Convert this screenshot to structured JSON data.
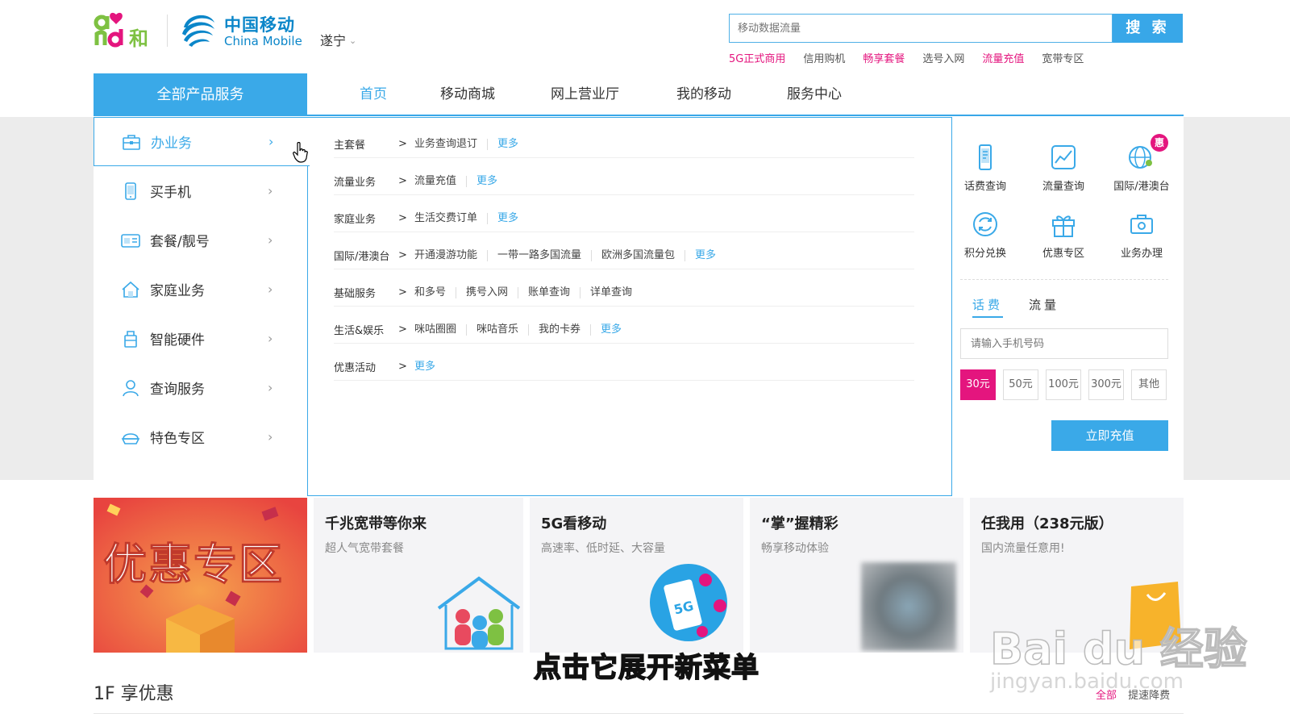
{
  "header": {
    "logo_left_text": "and和",
    "brand_cn": "中国移动",
    "brand_en": "China Mobile",
    "city": "遂宁",
    "search_placeholder": "移动数据流量",
    "search_button": "搜 索",
    "hot_words": [
      {
        "label": "5G正式商用",
        "highlight": true
      },
      {
        "label": "信用购机",
        "highlight": false
      },
      {
        "label": "畅享套餐",
        "highlight": true
      },
      {
        "label": "选号入网",
        "highlight": false
      },
      {
        "label": "流量充值",
        "highlight": true
      },
      {
        "label": "宽带专区",
        "highlight": false
      }
    ]
  },
  "nav": {
    "all_products": "全部产品服务",
    "items": [
      "首页",
      "移动商城",
      "网上营业厅",
      "我的移动",
      "服务中心"
    ],
    "active_index": 0
  },
  "sidebar": {
    "items": [
      {
        "label": "办业务",
        "icon": "briefcase-icon"
      },
      {
        "label": "买手机",
        "icon": "phone-icon"
      },
      {
        "label": "套餐/靓号",
        "icon": "card-icon"
      },
      {
        "label": "家庭业务",
        "icon": "home-icon"
      },
      {
        "label": "智能硬件",
        "icon": "device-icon"
      },
      {
        "label": "查询服务",
        "icon": "user-icon"
      },
      {
        "label": "特色专区",
        "icon": "special-icon"
      }
    ],
    "arrow": "›",
    "active_index": 0
  },
  "panel": {
    "rows": [
      {
        "head": "主套餐",
        "links": [
          "业务查询退订"
        ],
        "more": "更多"
      },
      {
        "head": "流量业务",
        "links": [
          "流量充值"
        ],
        "more": "更多"
      },
      {
        "head": "家庭业务",
        "links": [
          "生活交费订单"
        ],
        "more": "更多"
      },
      {
        "head": "国际/港澳台",
        "links": [
          "开通漫游功能",
          "一带一路多国流量",
          "欧洲多国流量包"
        ],
        "more": "更多"
      },
      {
        "head": "基础服务",
        "links": [
          "和多号",
          "携号入网",
          "账单查询",
          "详单查询"
        ],
        "more": ""
      },
      {
        "head": "生活&娱乐",
        "links": [
          "咪咕圈圈",
          "咪咕音乐",
          "我的卡券"
        ],
        "more": "更多"
      },
      {
        "head": "优惠活动",
        "links": [],
        "more": "更多"
      }
    ],
    "gt": ">"
  },
  "quick": {
    "items": [
      {
        "label": "话费查询",
        "icon": "bill-query-icon"
      },
      {
        "label": "流量查询",
        "icon": "traffic-query-icon"
      },
      {
        "label": "国际/港澳台",
        "icon": "globe-icon"
      },
      {
        "label": "积分兑换",
        "icon": "points-exchange-icon"
      },
      {
        "label": "优惠专区",
        "icon": "gift-icon"
      },
      {
        "label": "业务办理",
        "icon": "business-icon"
      }
    ],
    "badge": "惠"
  },
  "recharge": {
    "tabs": [
      "话费",
      "流量"
    ],
    "active_tab": 0,
    "phone_placeholder": "请输入手机号码",
    "amounts": [
      "30元",
      "50元",
      "100元",
      "300元",
      "其他"
    ],
    "selected_amount": 0,
    "button": "立即充值"
  },
  "cards": {
    "promo_text": "优惠专区",
    "items": [
      {
        "title": "千兆宽带等你来",
        "sub": "超人气宽带套餐"
      },
      {
        "title": "5G看移动",
        "sub": "高速率、低时延、大容量"
      },
      {
        "title": "“掌”握精彩",
        "sub": "畅享移动体验"
      },
      {
        "title": "任我用（238元版）",
        "sub": "国内流量任意用!"
      }
    ]
  },
  "floor": {
    "title": "1F 享优惠",
    "tabs": [
      "全部",
      "提速降费"
    ],
    "active_tab": 0
  },
  "overlay": {
    "caption": "点击它展开新菜单",
    "watermark_main": "Bai du 经验",
    "watermark_sub": "jingyan.baidu.com"
  },
  "colors": {
    "brand_blue": "#3aa9e8",
    "accent_pink": "#e4157e",
    "band_grey": "#ececec"
  }
}
